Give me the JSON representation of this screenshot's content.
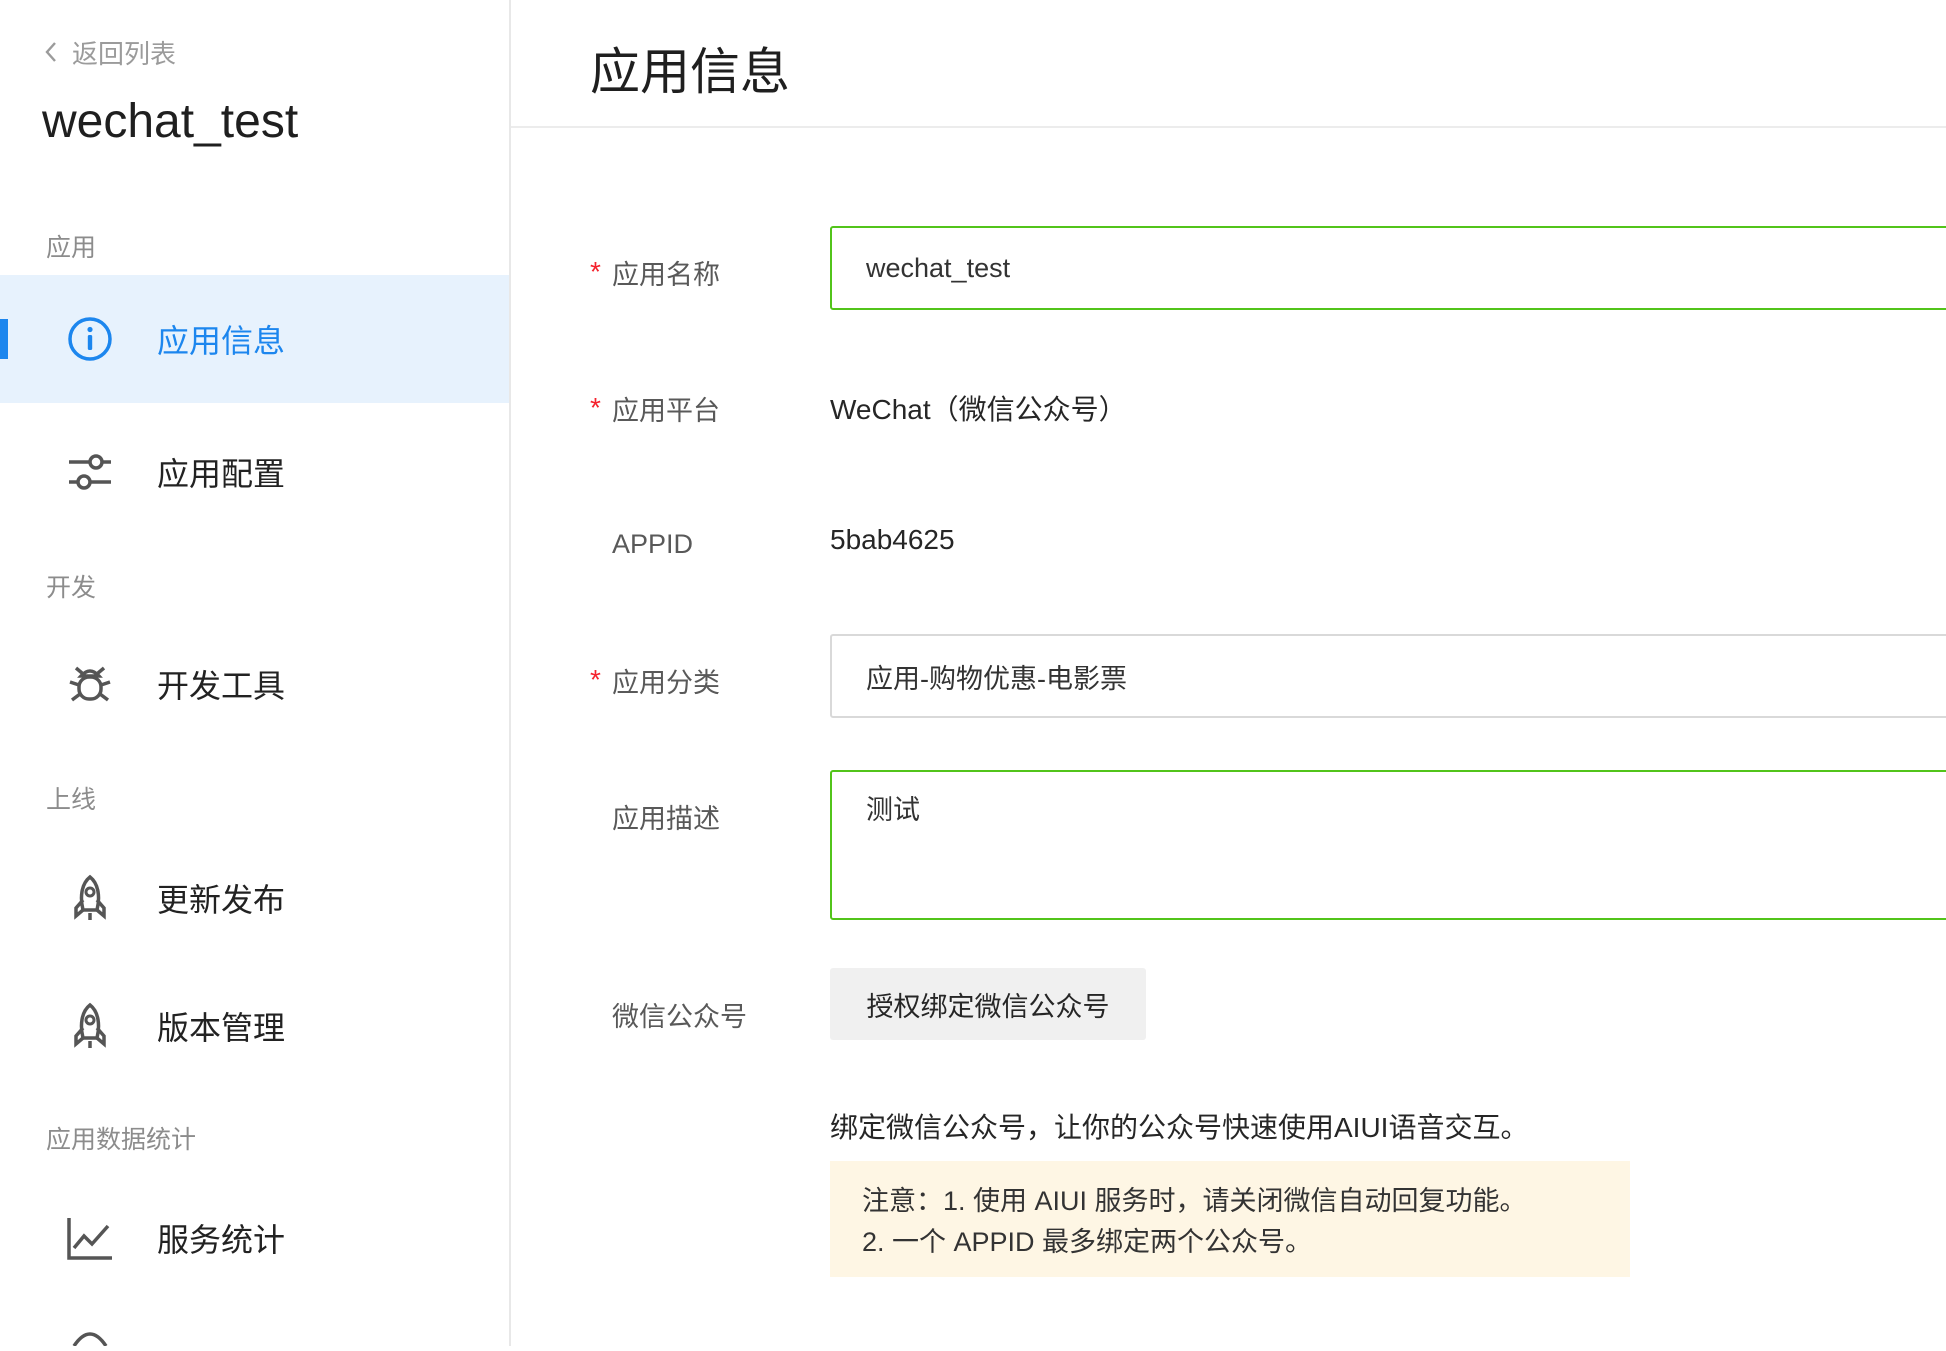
{
  "sidebar": {
    "back_label": "返回列表",
    "app_name": "wechat_test",
    "sections": [
      "应用",
      "开发",
      "上线",
      "应用数据统计"
    ],
    "items": [
      {
        "label": "应用信息",
        "icon": "info-circle-icon",
        "active": true
      },
      {
        "label": "应用配置",
        "icon": "sliders-icon",
        "active": false
      },
      {
        "label": "开发工具",
        "icon": "bug-icon",
        "active": false
      },
      {
        "label": "更新发布",
        "icon": "rocket-icon",
        "active": false
      },
      {
        "label": "版本管理",
        "icon": "rocket-icon",
        "active": false
      },
      {
        "label": "服务统计",
        "icon": "line-chart-icon",
        "active": false
      }
    ]
  },
  "header": {
    "title": "应用信息"
  },
  "form": {
    "required_mark": "*",
    "name": {
      "label": "应用名称",
      "value": "wechat_test"
    },
    "platform": {
      "label": "应用平台",
      "value": "WeChat（微信公众号）"
    },
    "appid": {
      "label": "APPID",
      "value": "5bab4625"
    },
    "category": {
      "label": "应用分类",
      "value": "应用-购物优惠-电影票"
    },
    "description": {
      "label": "应用描述",
      "value": "测试"
    },
    "wechat": {
      "label": "微信公众号",
      "button_label": "授权绑定微信公众号",
      "hint": "绑定微信公众号，让你的公众号快速使用AIUI语音交互。",
      "notice_line1": "注意：1. 使用 AIUI 服务时，请关闭微信自动回复功能。",
      "notice_line2": "2. 一个 APPID 最多绑定两个公众号。"
    }
  },
  "colors": {
    "accent": "#1c86ee",
    "focus_border": "#52c41a",
    "required": "#f5222d",
    "notice_bg": "#fef6e4"
  }
}
